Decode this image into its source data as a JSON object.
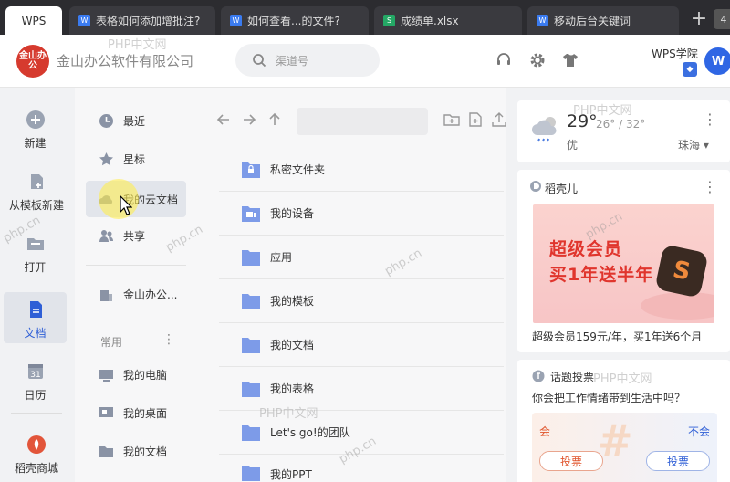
{
  "tabs": [
    {
      "label": "WPS",
      "type": "home"
    },
    {
      "label": "表格如何添加增批注?",
      "type": "w"
    },
    {
      "label": "如何查看...的文件?",
      "type": "w"
    },
    {
      "label": "成绩单.xlsx",
      "type": "s"
    },
    {
      "label": "移动后台关键词",
      "type": "w"
    }
  ],
  "tabbar": {
    "new_tab": "+",
    "more": "4"
  },
  "header": {
    "logo_text": "金山办公",
    "company": "金山办公软件有限公司",
    "search_placeholder": "渠道号",
    "academy": "WPS学院",
    "wps_logo": "W"
  },
  "leftnav": [
    {
      "label": "新建",
      "icon": "plus-circle-icon"
    },
    {
      "label": "从模板新建",
      "icon": "template-icon"
    },
    {
      "label": "打开",
      "icon": "folder-open-icon"
    },
    {
      "label": "文档",
      "icon": "document-icon",
      "active": true
    },
    {
      "label": "日历",
      "icon": "calendar-icon",
      "day": "31"
    },
    {
      "label": "稻壳商城",
      "icon": "docer-icon"
    }
  ],
  "midnav": {
    "items": [
      {
        "label": "最近",
        "icon": "clock-icon"
      },
      {
        "label": "星标",
        "icon": "star-icon"
      },
      {
        "label": "我的云文档",
        "icon": "cloud-icon",
        "active": true
      },
      {
        "label": "共享",
        "icon": "share-icon"
      },
      {
        "label": "金山办公...",
        "icon": "company-icon"
      }
    ],
    "section_label": "常用",
    "section_more": "⋮",
    "common": [
      {
        "label": "我的电脑",
        "icon": "computer-icon"
      },
      {
        "label": "我的桌面",
        "icon": "desktop-icon"
      },
      {
        "label": "我的文档",
        "icon": "folder-icon"
      }
    ]
  },
  "files": [
    {
      "name": "私密文件夹",
      "icon": "lock-folder-icon"
    },
    {
      "name": "我的设备",
      "icon": "device-folder-icon"
    },
    {
      "name": "应用",
      "icon": "folder-icon"
    },
    {
      "name": "我的模板",
      "icon": "folder-icon"
    },
    {
      "name": "我的文档",
      "icon": "folder-icon"
    },
    {
      "name": "我的表格",
      "icon": "folder-icon"
    },
    {
      "name": "Let's go!的团队",
      "icon": "folder-icon"
    },
    {
      "name": "我的PPT",
      "icon": "folder-icon"
    }
  ],
  "weather": {
    "temp": "29°",
    "range": "26° / 32°",
    "condition": "优",
    "city": "珠海 ▾",
    "more": "⋮"
  },
  "ad": {
    "brand": "稻壳儿",
    "line1": "超级会员",
    "line2": "买1年送半年",
    "caption": "超级会员159元/年，买1年送6个月",
    "more": "⋮",
    "badge": "S"
  },
  "poll": {
    "title": "话题投票",
    "question": "你会把工作情绪带到生活中吗？",
    "yes": "会",
    "no": "不会",
    "vote_yes": "投票",
    "vote_no": "投票"
  },
  "watermarks": [
    "PHP中文网",
    "PHP中文网",
    "PHP中文网",
    "PHP中文网",
    "php.cn",
    "php.cn",
    "php.cn",
    "php.cn",
    "php.cn"
  ],
  "colors": {
    "accent": "#2f5fd6",
    "folder": "#7d9be8",
    "brand_red": "#d63a2e"
  }
}
